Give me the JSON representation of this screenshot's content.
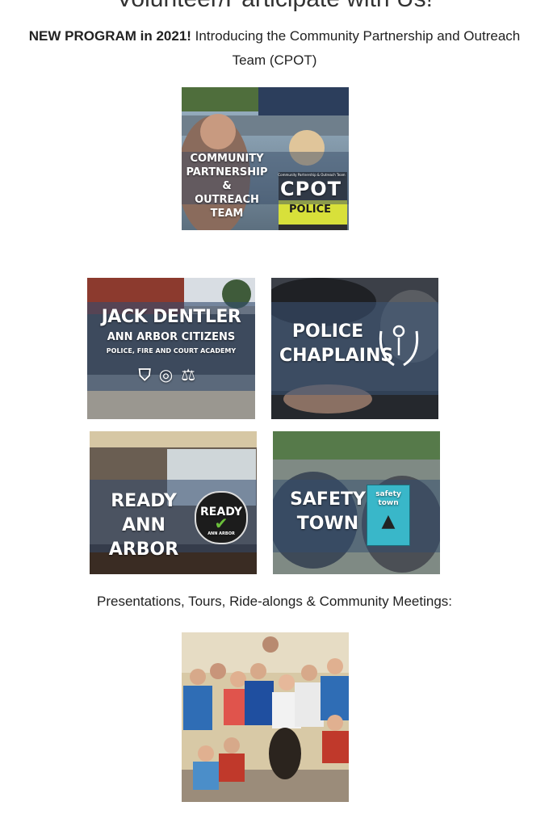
{
  "heading": "Volunteer/Participate with Us!",
  "intro": {
    "bold": "NEW PROGRAM in 2021!",
    "rest": " Introducing the Community Partnership and Outreach Team (CPOT)"
  },
  "tiles": {
    "cpot": {
      "line1": "COMMUNITY",
      "line2": "PARTNERSHIP &",
      "line3": "OUTREACH TEAM",
      "logo": "CPOT",
      "logo_small": "Community Partnership & Outreach Team",
      "badge": "POLICE"
    },
    "dentler": {
      "title": "JACK DENTLER",
      "subtitle": "ANN ARBOR CITIZENS",
      "small": "POLICE, FIRE AND COURT ACADEMY"
    },
    "chaplains": {
      "line1": "POLICE",
      "line2": "CHAPLAINS"
    },
    "ready": {
      "line1": "READY",
      "line2": "ANN ARBOR",
      "badge": "READY",
      "badge_sub": "ANN ARBOR"
    },
    "safety": {
      "line1": "SAFETY",
      "line2": "TOWN",
      "sign1": "safety",
      "sign2": "town"
    }
  },
  "presentations_title": "Presentations, Tours, Ride-alongs & Community Meetings:",
  "colors": {
    "band": "#3b5478",
    "cpot_rainbow": [
      "#e84c3d",
      "#f39c12",
      "#f1c40f",
      "#2ecc71",
      "#3498db",
      "#9b59b6"
    ],
    "ready_check": "#6bbf3b",
    "safety_sign": "#39b7c9"
  }
}
